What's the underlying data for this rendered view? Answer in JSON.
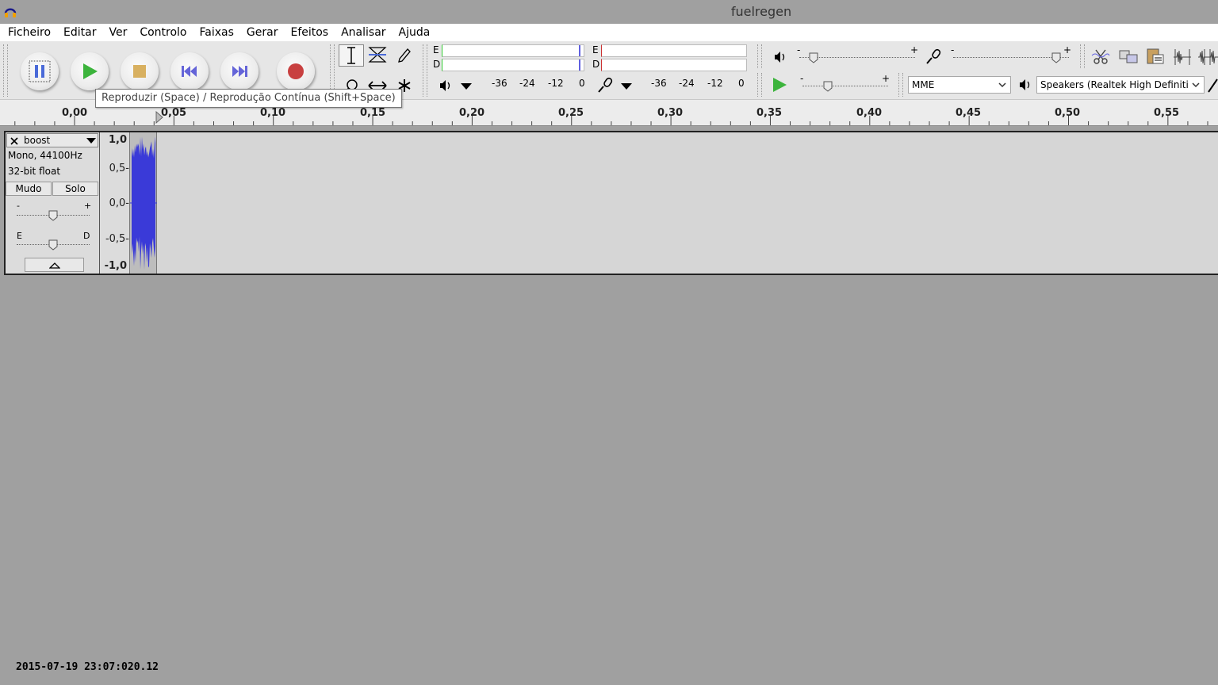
{
  "window": {
    "title": "fuelregen"
  },
  "menu": [
    "Ficheiro",
    "Editar",
    "Ver",
    "Controlo",
    "Faixas",
    "Gerar",
    "Efeitos",
    "Analisar",
    "Ajuda"
  ],
  "transport": {
    "buttons": [
      "pause-icon",
      "play-icon",
      "stop-icon",
      "skip-start-icon",
      "skip-end-icon",
      "record-icon"
    ]
  },
  "tooltip": "Reproduzir (Space) / Reprodução Contínua (Shift+Space)",
  "meters": {
    "left_label": "E",
    "right_label": "D",
    "playback_scale": [
      "-36",
      "-24",
      "-12",
      "0"
    ],
    "record_scale": [
      "-36",
      "-24",
      "-12",
      "0"
    ]
  },
  "mixer": {
    "minus": "-",
    "plus": "+"
  },
  "device": {
    "host": "MME",
    "output": "Speakers (Realtek High Definiti"
  },
  "ruler": {
    "ticks": [
      "0,00",
      "0,05",
      "0,10",
      "0,15",
      "0,20",
      "0,25",
      "0,30",
      "0,35",
      "0,40",
      "0,45",
      "0,50",
      "0,55"
    ]
  },
  "track": {
    "name": "boost",
    "info_line1": "Mono, 44100Hz",
    "info_line2": "32-bit float",
    "mute": "Mudo",
    "solo": "Solo",
    "gain_minus": "-",
    "gain_plus": "+",
    "pan_left": "E",
    "pan_right": "D",
    "vruler": [
      "1,0",
      "0,5-",
      "0,0-",
      "-0,5-",
      "-1,0"
    ]
  },
  "timestamp": "2015-07-19 23:07:020.12",
  "colors": {
    "wave": "#3a3ad8",
    "play": "#3cb43c",
    "record": "#c83c3c",
    "accent": "#6060e0"
  }
}
